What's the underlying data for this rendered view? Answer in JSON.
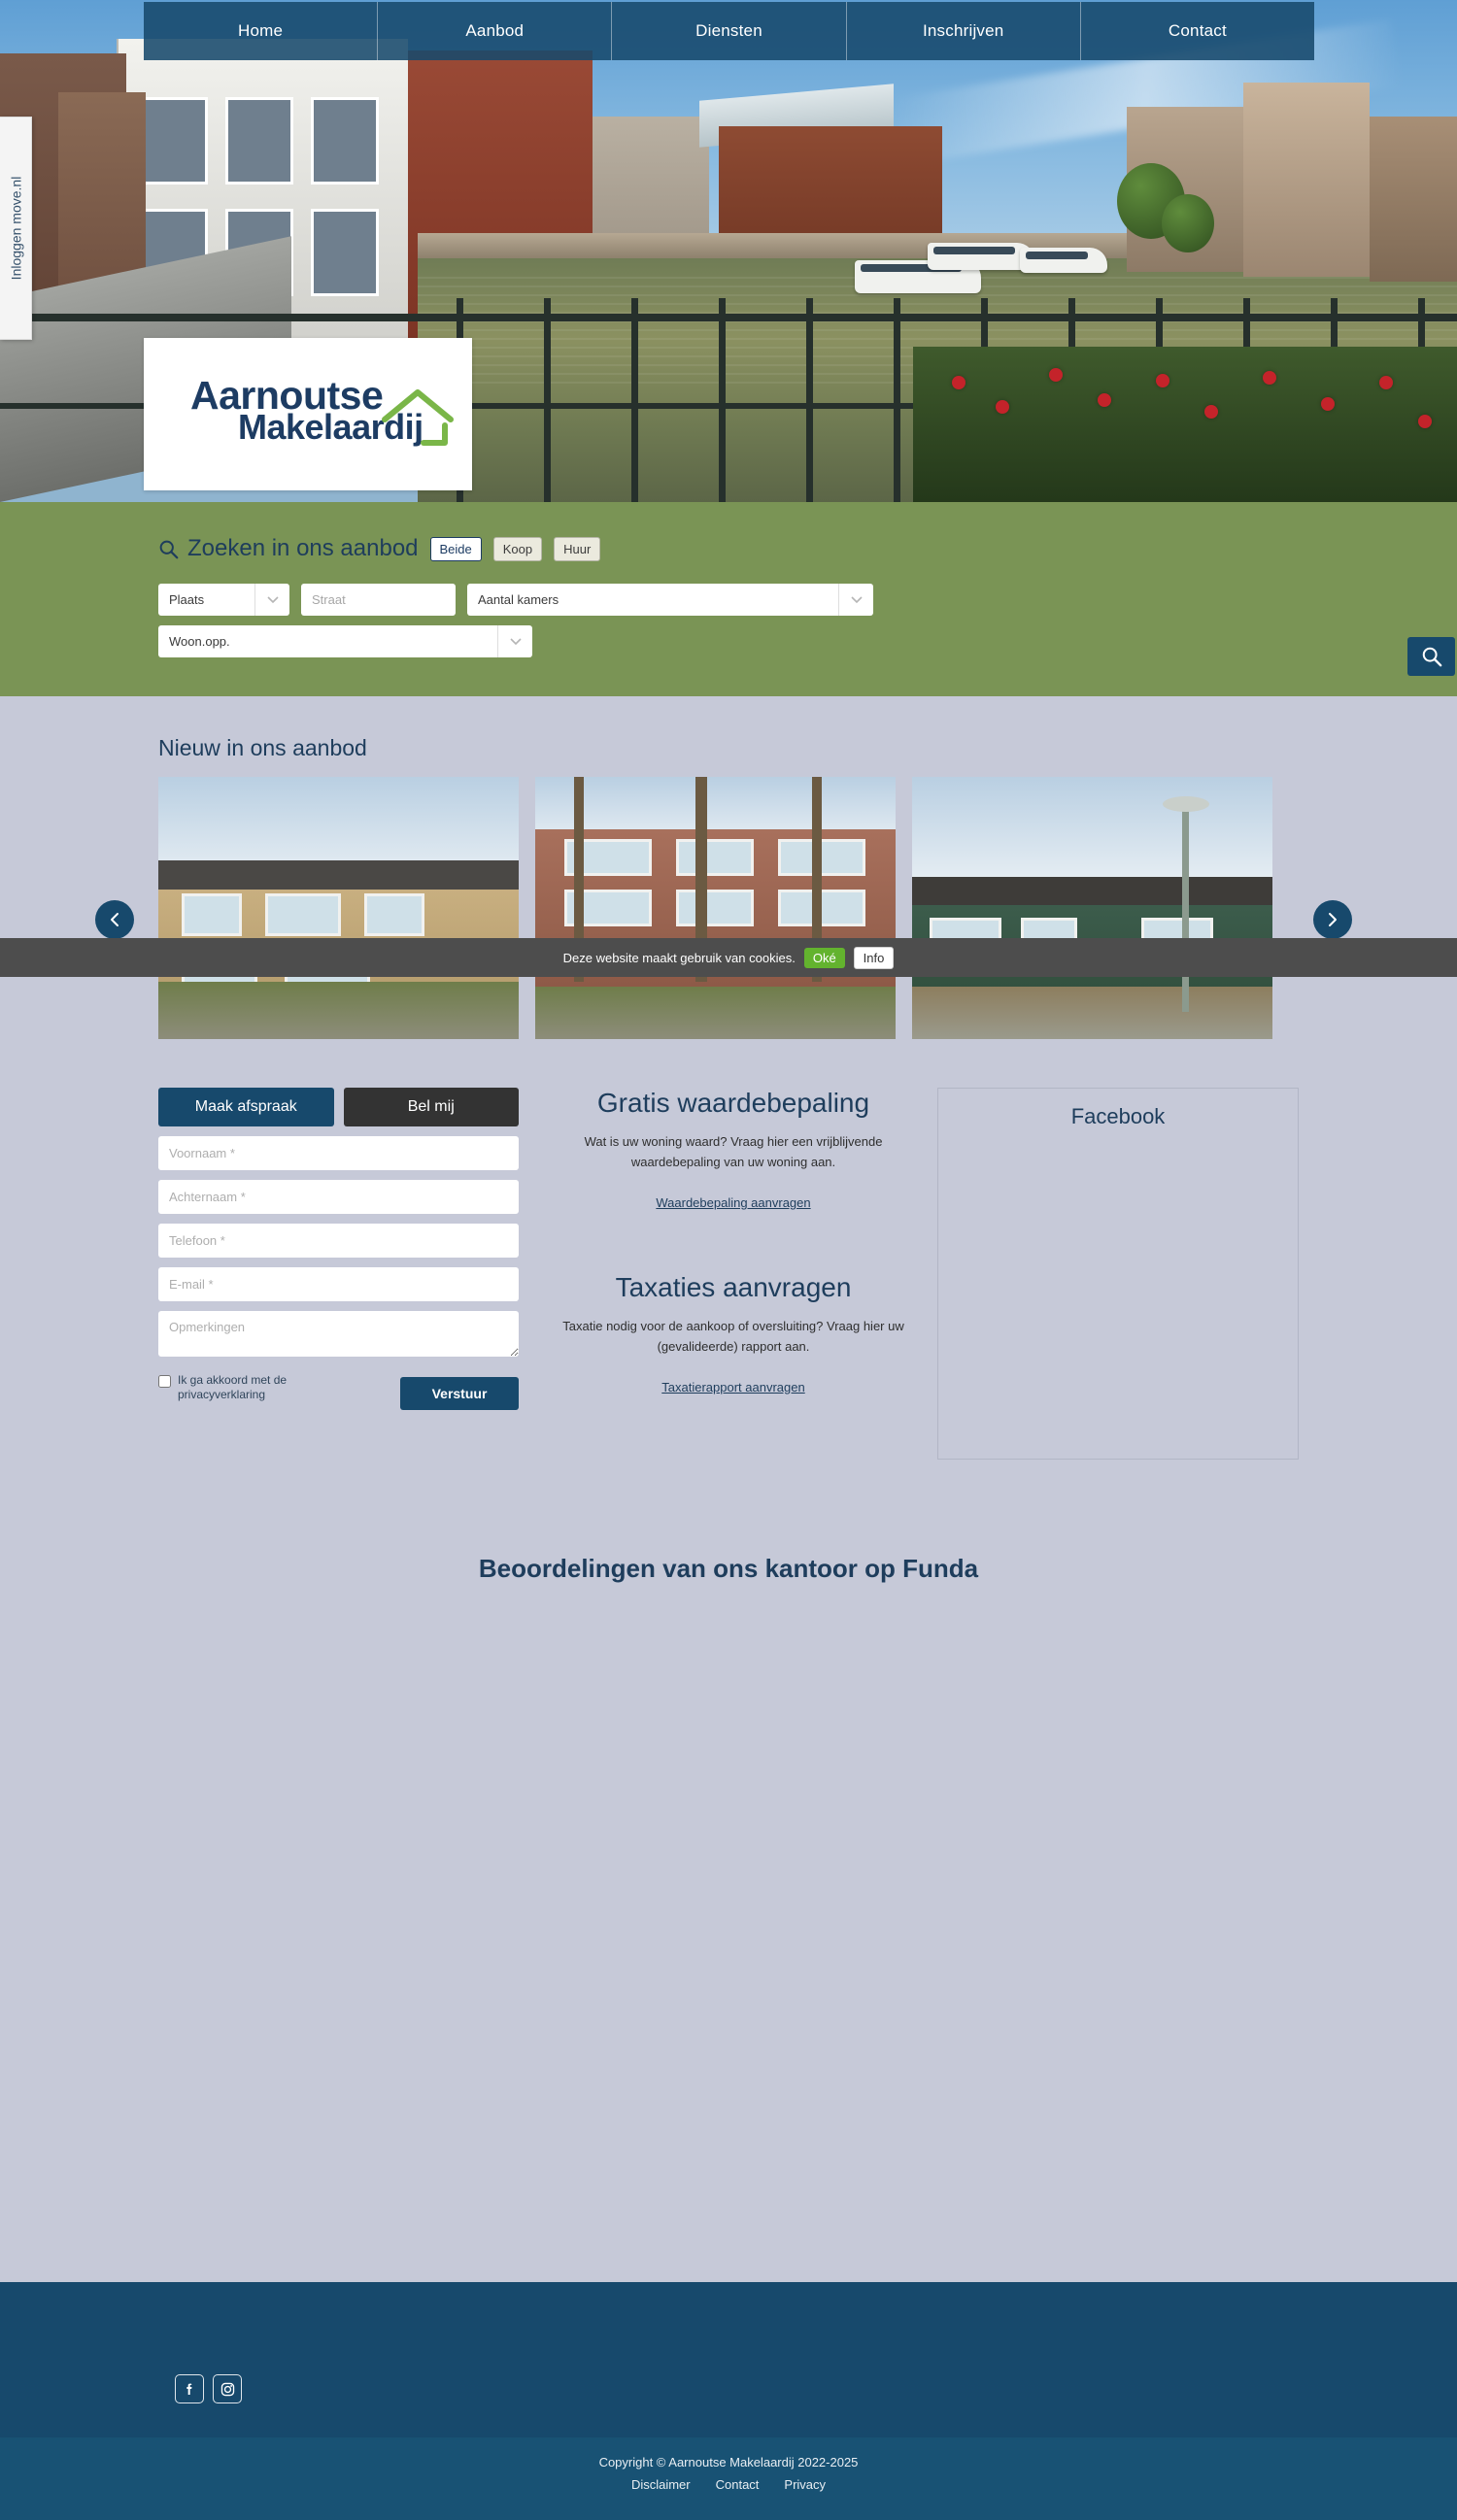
{
  "nav": {
    "items": [
      {
        "label": "Home"
      },
      {
        "label": "Aanbod"
      },
      {
        "label": "Diensten"
      },
      {
        "label": "Inschrijven"
      },
      {
        "label": "Contact"
      }
    ]
  },
  "login_tab": {
    "label": "Inloggen move.nl"
  },
  "logo": {
    "line1": "Aarnoutse",
    "line2": "Makelaardij",
    "color": "#1d3c63",
    "accent": "#7ab648"
  },
  "search": {
    "title": "Zoeken in ons aanbod",
    "band_color": "#7a9455",
    "segments": [
      {
        "label": "Beide",
        "active": true
      },
      {
        "label": "Koop",
        "active": false
      },
      {
        "label": "Huur",
        "active": false
      }
    ],
    "fields": {
      "plaats": "Plaats",
      "straat_placeholder": "Straat",
      "kamers": "Aantal kamers",
      "oppervlakte": "Woon.opp."
    },
    "button_icon": "search-icon"
  },
  "listings": {
    "title": "Nieuw in ons aanbod",
    "prev_icon": "chevron-left-icon",
    "next_icon": "chevron-right-icon",
    "cards": [
      {
        "alt": "rijtjeswoning geel baksteen"
      },
      {
        "alt": "appartementencomplex met bomen"
      },
      {
        "alt": "rijtjeswoning groen gevelbekleding"
      }
    ]
  },
  "cookie": {
    "text": "Deze website maakt gebruik van cookies.",
    "accept_label": "Oké",
    "info_label": "Info",
    "accept_color": "#63b32e"
  },
  "contact_form": {
    "tabs": [
      {
        "label": "Maak afspraak",
        "active": true
      },
      {
        "label": "Bel mij",
        "active": false
      }
    ],
    "fields": [
      {
        "placeholder": "Voornaam *",
        "value": ""
      },
      {
        "placeholder": "Achternaam *",
        "value": ""
      },
      {
        "placeholder": "Telefoon *",
        "value": ""
      },
      {
        "placeholder": "E-mail *",
        "value": ""
      }
    ],
    "textarea": {
      "placeholder": "Opmerkingen",
      "value": ""
    },
    "agree_label": "Ik ga akkoord met de privacyverklaring",
    "submit_label": "Verstuur"
  },
  "promos": [
    {
      "heading": "Gratis waardebepaling",
      "body": "Wat is uw woning waard? Vraag hier een vrijblijvende waardebepaling van uw woning aan.",
      "link": "Waardebepaling aanvragen"
    },
    {
      "heading": "Taxaties aanvragen",
      "body": "Taxatie nodig voor de aankoop of oversluiting? Vraag hier uw (gevalideerde) rapport aan.",
      "link": "Taxatierapport aanvragen"
    }
  ],
  "facebook": {
    "heading": "Facebook"
  },
  "funda": {
    "heading": "Beoordelingen van ons kantoor op Funda"
  },
  "footer": {
    "socials": [
      {
        "name": "facebook-icon"
      },
      {
        "name": "instagram-icon"
      }
    ],
    "copyright": "Copyright © Aarnoutse Makelaardij 2022-2025",
    "links": [
      {
        "label": "Disclaimer"
      },
      {
        "label": "Contact"
      },
      {
        "label": "Privacy"
      }
    ],
    "bg_color": "#17496c"
  }
}
